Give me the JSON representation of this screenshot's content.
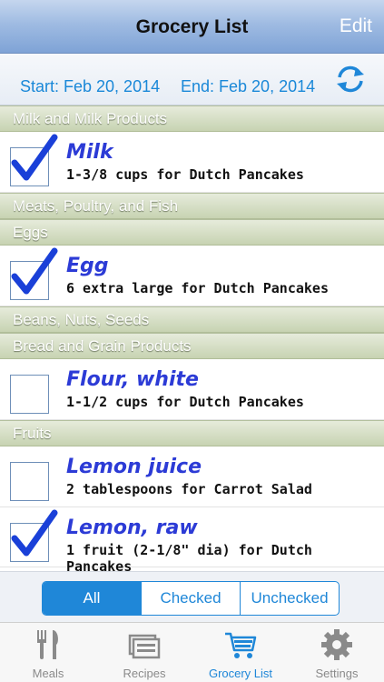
{
  "nav": {
    "title": "Grocery List",
    "edit_label": "Edit"
  },
  "dates": {
    "start": "Start: Feb 20, 2014",
    "end": "End: Feb 20, 2014"
  },
  "sections": {
    "milk": "Milk and Milk Products",
    "meats": "Meats, Poultry, and Fish",
    "eggs": "Eggs",
    "beans": "Beans, Nuts, Seeds",
    "bread": "Bread and Grain Products",
    "fruits": "Fruits"
  },
  "items": [
    {
      "name": "Milk",
      "detail": "1-3/8 cups for Dutch Pancakes",
      "checked": true
    },
    {
      "name": "Egg",
      "detail": "6 extra large for Dutch Pancakes",
      "checked": true
    },
    {
      "name": "Flour, white",
      "detail": "1-1/2 cups for Dutch Pancakes",
      "checked": false
    },
    {
      "name": "Lemon juice",
      "detail": "2 tablespoons for Carrot Salad",
      "checked": false
    },
    {
      "name": "Lemon, raw",
      "detail": "1 fruit (2-1/8\" dia) for Dutch Pancakes",
      "checked": true
    }
  ],
  "filter": {
    "all": "All",
    "checked": "Checked",
    "unchecked": "Unchecked",
    "selected": "All"
  },
  "tabs": [
    {
      "label": "Meals",
      "icon": "fork-knife-icon"
    },
    {
      "label": "Recipes",
      "icon": "recipes-icon"
    },
    {
      "label": "Grocery List",
      "icon": "cart-icon"
    },
    {
      "label": "Settings",
      "icon": "gear-icon"
    }
  ],
  "colors": {
    "accent": "#1f87d8",
    "check": "#1a40d8",
    "item_name": "#2c3bd6"
  }
}
